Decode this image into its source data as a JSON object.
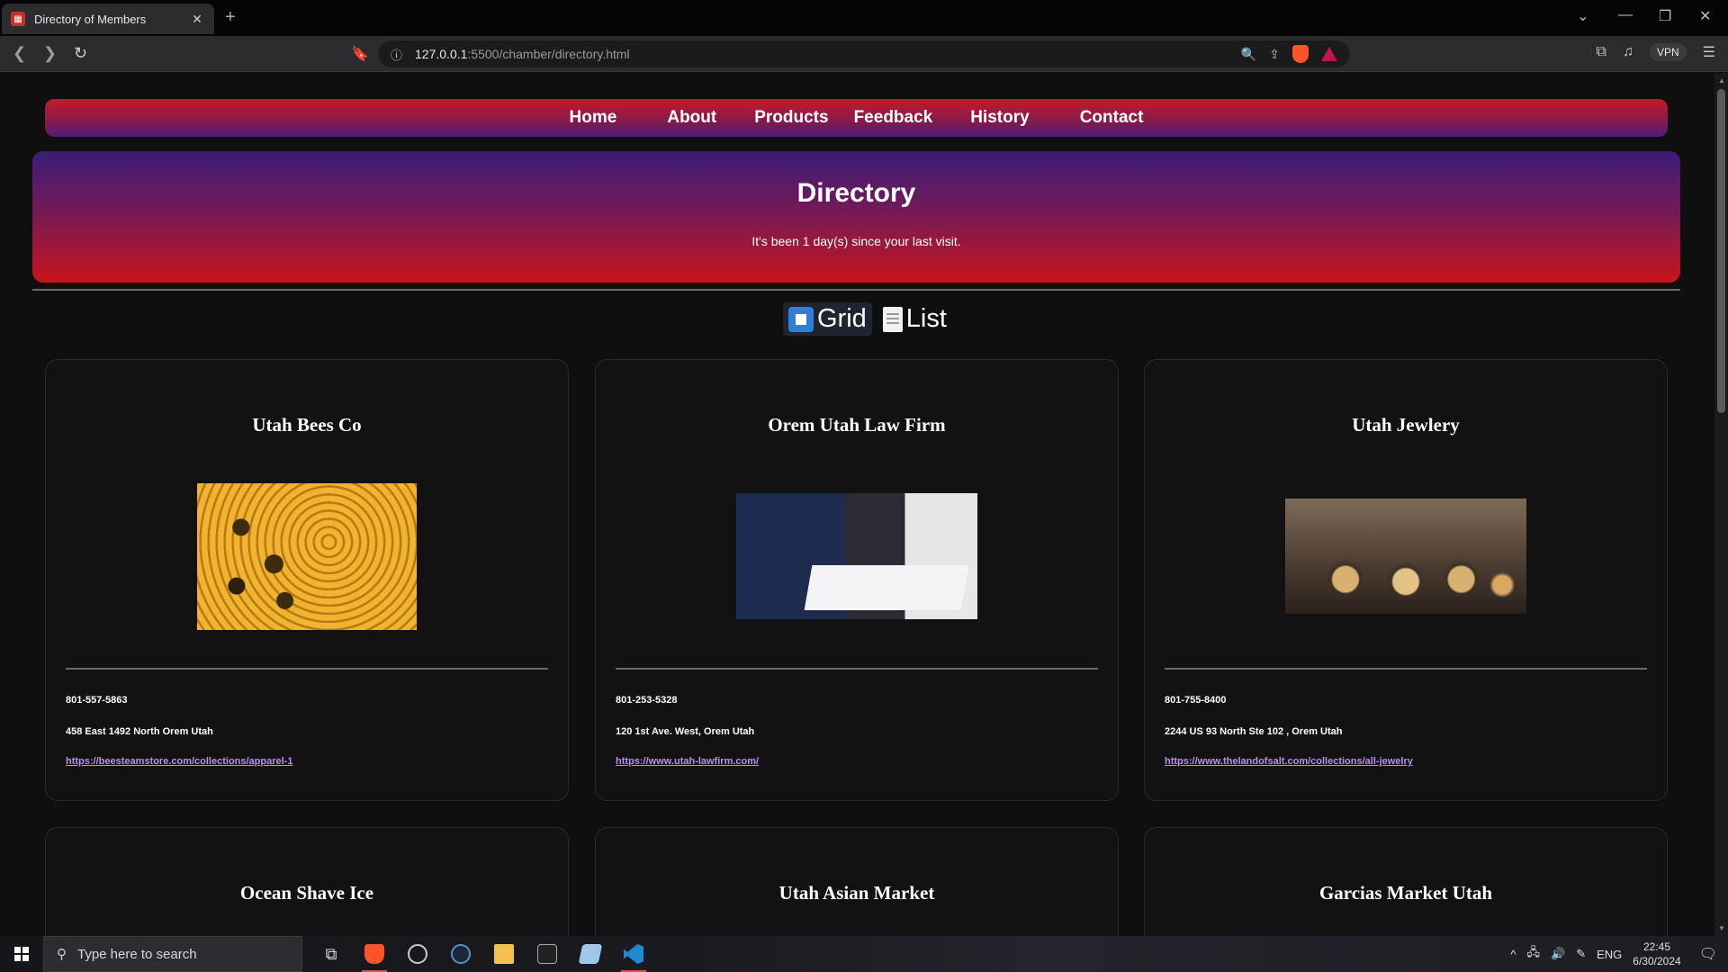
{
  "browser": {
    "tab_title": "Directory of Members",
    "tab_close": "✕",
    "new_tab": "+",
    "url_host": "127.0.0.1",
    "url_path": ":5500/chamber/directory.html",
    "vpn_label": "VPN"
  },
  "nav": {
    "items": [
      "Home",
      "About",
      "Products",
      "Feedback",
      "History",
      "Contact"
    ]
  },
  "hero": {
    "title": "Directory",
    "visit_message": "It's been 1 day(s) since your last visit."
  },
  "view_toggle": {
    "grid_label": "Grid",
    "list_label": "List",
    "active": "grid"
  },
  "members": [
    {
      "name": "Utah Bees Co",
      "phone": "801-557-5863",
      "address": "458 East 1492 North Orem Utah",
      "url": "https://beesteamstore.com/collections/apparel-1"
    },
    {
      "name": "Orem Utah Law Firm",
      "phone": "801-253-5328",
      "address": "120 1st Ave. West, Orem Utah",
      "url": "https://www.utah-lawfirm.com/"
    },
    {
      "name": "Utah Jewlery",
      "phone": "801-755-8400",
      "address": "2244 US 93 North Ste 102 , Orem Utah",
      "url": "https://www.thelandofsalt.com/collections/all-jewelry"
    },
    {
      "name": "Ocean Shave Ice"
    },
    {
      "name": "Utah Asian Market"
    },
    {
      "name": "Garcias Market Utah"
    }
  ],
  "taskbar": {
    "search_placeholder": "Type here to search",
    "language": "ENG",
    "time": "22:45",
    "date": "6/30/2024"
  },
  "colors": {
    "nav_gradient": [
      "#c41a2a",
      "#4a1f78"
    ],
    "hero_gradient": [
      "#3b1c7a",
      "#c8151c"
    ],
    "link": "#b990f0"
  }
}
